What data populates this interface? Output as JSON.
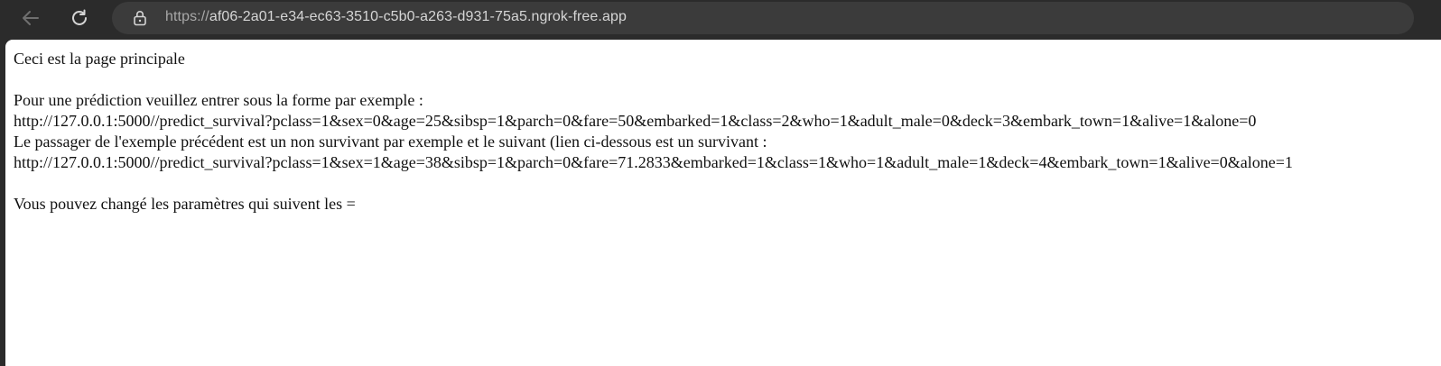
{
  "browser": {
    "url_protocol": "https://",
    "url_host": "af06-2a01-e34-ec63-3510-c5b0-a263-d931-75a5.ngrok-free.app",
    "icons": [
      "back-arrow-icon",
      "reload-icon",
      "lock-icon",
      "read-aloud-icon"
    ]
  },
  "page": {
    "heading_line": "Ceci est la page principale",
    "instruction": "Pour une prédiction veuillez entrer sous la forme par exemple :",
    "example_url_1": "http://127.0.0.1:5000//predict_survival?pclass=1&sex=0&age=25&sibsp=1&parch=0&fare=50&embarked=1&class=2&who=1&adult_male=0&deck=3&embark_town=1&alive=1&alone=0",
    "explanation": "Le passager de l'exemple précédent est un non survivant par exemple et le suivant (lien ci-dessous est un survivant :",
    "example_url_2": "http://127.0.0.1:5000//predict_survival?pclass=1&sex=1&age=38&sibsp=1&parch=0&fare=71.2833&embarked=1&class=1&who=1&adult_male=1&deck=4&embark_town=1&alive=0&alone=1",
    "footer_note": "Vous pouvez changé les paramètres qui suivent les ="
  }
}
